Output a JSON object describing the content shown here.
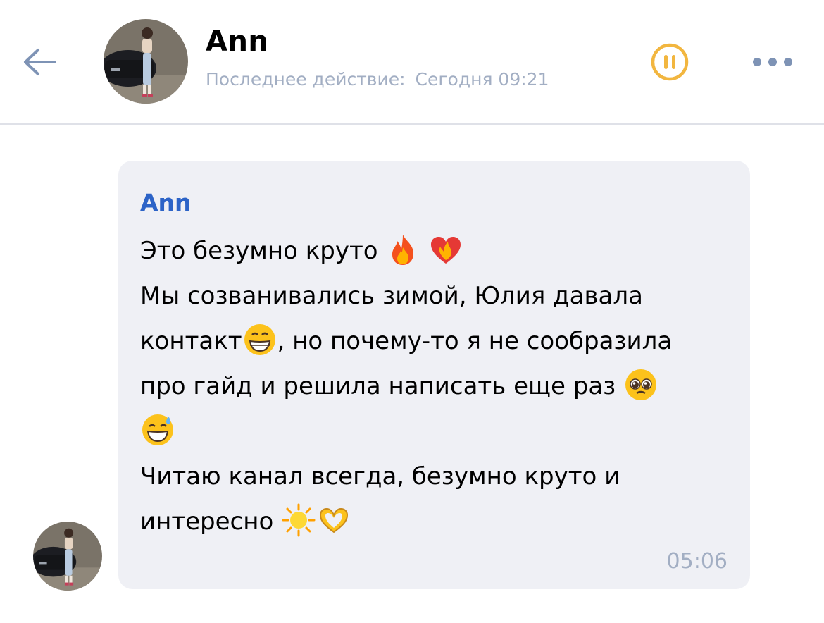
{
  "header": {
    "contact_name": "Ann",
    "last_seen_label": "Последнее действие:",
    "last_seen_time": "Сегодня 09:21"
  },
  "message": {
    "sender": "Ann",
    "lines": [
      "Это безумно круто",
      "Мы созванивались зимой, Юлия давала",
      "контакт",
      ", но почему-то я не сообразила",
      "про гайд и решила написать еще раз",
      "Читаю канал всегда, безумно круто и",
      "интересно"
    ],
    "time": "05:06"
  },
  "colors": {
    "accent": "#2c63c7",
    "secondary_text": "#a2aec3",
    "bubble_bg": "#eff0f5",
    "icon_blue": "#7e93b5",
    "pause_yellow": "#f2b63f"
  },
  "icons": [
    "back-arrow-icon",
    "pause-icon",
    "more-icon",
    "fire-emoji",
    "heart-on-fire-emoji",
    "grinning-emoji",
    "pleading-emoji",
    "sweat-smile-emoji",
    "sun-emoji",
    "heart-hands-emoji"
  ]
}
